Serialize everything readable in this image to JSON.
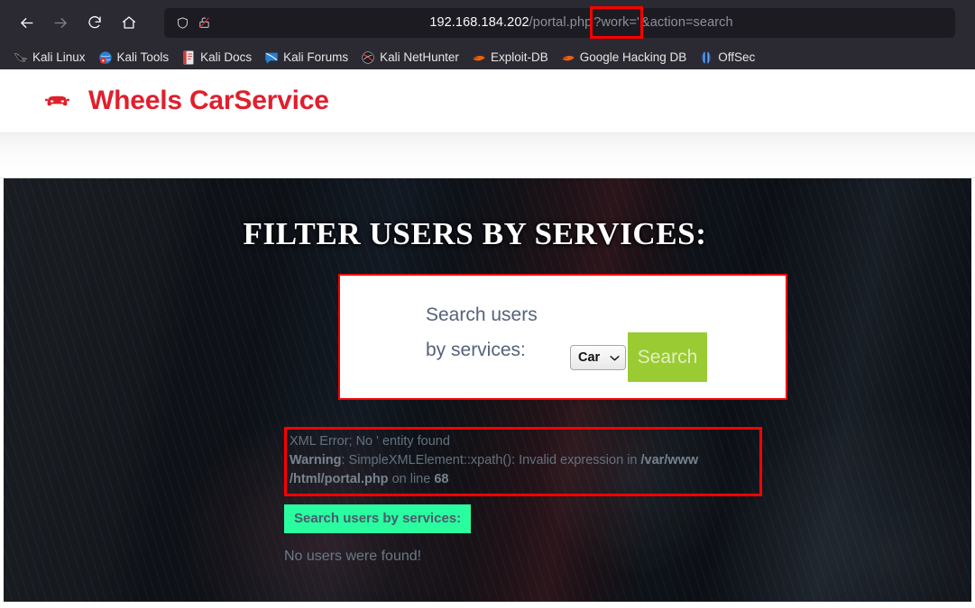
{
  "browser": {
    "nav": {
      "back": "back-arrow",
      "forward": "forward-arrow",
      "reload": "reload",
      "home": "home"
    },
    "urlbar": {
      "shield_icon": "shield-icon",
      "lock_icon": "lock-broken-icon",
      "host": "192.168.184.202",
      "path": "/portal.php",
      "highlighted_query": "?work='",
      "rest_query": "&action=search",
      "full_url": "192.168.184.202/portal.php?work='&action=search"
    },
    "bookmarks": [
      {
        "label": "Kali Linux",
        "icon": "kali-dragon-icon"
      },
      {
        "label": "Kali Tools",
        "icon": "kali-tools-icon"
      },
      {
        "label": "Kali Docs",
        "icon": "kali-docs-icon"
      },
      {
        "label": "Kali Forums",
        "icon": "kali-forums-icon"
      },
      {
        "label": "Kali NetHunter",
        "icon": "kali-nethunter-icon"
      },
      {
        "label": "Exploit-DB",
        "icon": "exploit-db-icon"
      },
      {
        "label": "Google Hacking DB",
        "icon": "google-hacking-db-icon"
      },
      {
        "label": "OffSec",
        "icon": "offsec-icon"
      }
    ]
  },
  "site": {
    "brand": {
      "name": "Wheels CarService",
      "icon": "car-icon",
      "color": "#e01f2d"
    },
    "hero": {
      "title": "FILTER USERS BY SERVICES:",
      "card": {
        "label": "Search users\nby services:",
        "select": {
          "value": "Car",
          "options": [
            "Car"
          ]
        },
        "button_label": "Search",
        "button_color": "#9ACB33",
        "border_color": "#fe0000"
      },
      "results": {
        "error_box_color": "#fe0000",
        "error_lines": [
          {
            "text": "XML Error; No ' entity found",
            "bold_parts": []
          },
          {
            "text": "Warning: SimpleXMLElement::xpath(): Invalid expression in /var/www",
            "bold_parts": [
              "Warning",
              "/var/www"
            ]
          },
          {
            "text": "/html/portal.php on line 68",
            "bold_parts": [
              "/html/portal.php",
              "68"
            ]
          }
        ],
        "error_line_1": "XML Error; No ' entity found",
        "error_line_2_bold": "Warning",
        "error_line_2_rest": ": SimpleXMLElement::xpath(): Invalid expression in ",
        "error_line_2_path": "/var/www",
        "error_line_3_path": "/html/portal.php",
        "error_line_3_mid": " on line ",
        "error_line_3_num": "68",
        "found_banner": "Search users by services:",
        "found_banner_color": "#2afca0",
        "no_users": "No users were found!"
      }
    }
  }
}
